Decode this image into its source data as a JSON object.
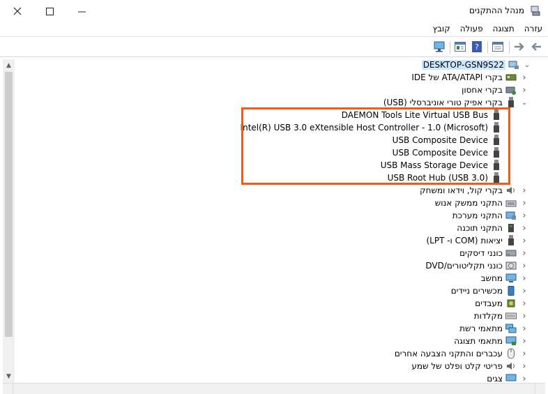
{
  "window": {
    "title": "מנהל ההתקנים",
    "min_glyph": "—",
    "max_glyph": "☐",
    "close_glyph": "✕"
  },
  "menu": [
    "קובץ",
    "פעולה",
    "תצוגה",
    "עזרה"
  ],
  "toolbar_icons": [
    "back-icon",
    "forward-icon",
    "properties-icon",
    "help-icon",
    "update-driver-icon",
    "scan-hardware-icon"
  ],
  "tree": {
    "root": "DESKTOP-GSN9S22",
    "categories": [
      {
        "label": "בקרי ATA/ATAPI של IDE",
        "icon": "ide-controller-icon",
        "expanded": false
      },
      {
        "label": "בקרי אחסון",
        "icon": "storage-controller-icon",
        "expanded": false
      },
      {
        "label": "בקרי אפיק טורי אוניברסלי (USB)",
        "icon": "usb-icon",
        "expanded": true,
        "children": [
          "DAEMON Tools Lite Virtual USB Bus",
          "Intel(R) USB 3.0 eXtensible Host Controller - 1.0 (Microsoft)",
          "USB Composite Device",
          "USB Composite Device",
          "USB Mass Storage Device",
          "USB Root Hub (USB 3.0)"
        ]
      },
      {
        "label": "בקרי קול, וידאו ומשחק",
        "icon": "speaker-icon",
        "expanded": false
      },
      {
        "label": "התקני ממשק אנוש",
        "icon": "hid-icon",
        "expanded": false
      },
      {
        "label": "התקני מערכת",
        "icon": "system-devices-icon",
        "expanded": false
      },
      {
        "label": "התקני תוכנה",
        "icon": "software-devices-icon",
        "expanded": false
      },
      {
        "label": "יציאות (COM ו- LPT)",
        "icon": "port-icon",
        "expanded": false
      },
      {
        "label": "כונני דיסקים",
        "icon": "disk-drive-icon",
        "expanded": false
      },
      {
        "label": "כונני תקליטורים/DVD",
        "icon": "dvd-icon",
        "expanded": false
      },
      {
        "label": "מחשב",
        "icon": "computer-icon",
        "expanded": false
      },
      {
        "label": "מכשירים ניידים",
        "icon": "portable-device-icon",
        "expanded": false
      },
      {
        "label": "מעבדים",
        "icon": "processor-icon",
        "expanded": false
      },
      {
        "label": "מקלדות",
        "icon": "keyboard-icon",
        "expanded": false
      },
      {
        "label": "מתאמי רשת",
        "icon": "network-adapter-icon",
        "expanded": false
      },
      {
        "label": "מתאמי תצוגה",
        "icon": "display-adapter-icon",
        "expanded": false
      },
      {
        "label": "עכברים והתקני הצבעה אחרים",
        "icon": "mouse-icon",
        "expanded": false
      },
      {
        "label": "פריטי קלט ופלט של שמע",
        "icon": "audio-io-icon",
        "expanded": false
      },
      {
        "label": "צגים",
        "icon": "monitor-icon",
        "expanded": false
      }
    ]
  },
  "colors": {
    "highlight_box": "#f25a1a",
    "root_selection": "#cce8ff"
  }
}
